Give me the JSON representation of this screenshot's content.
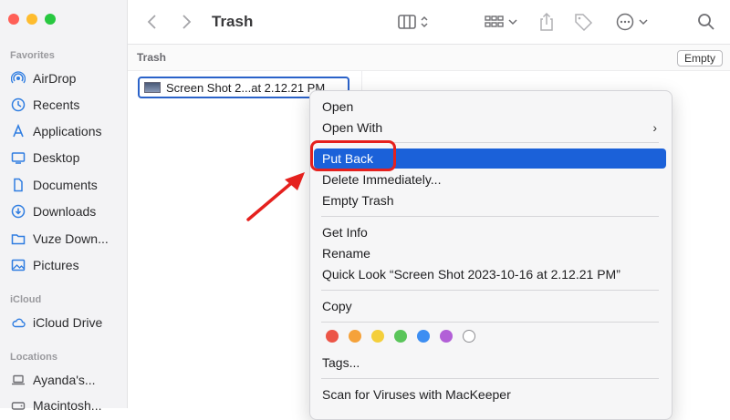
{
  "window": {
    "title": "Trash",
    "traffic_colors": [
      "#ff5f57",
      "#febc2e",
      "#28c840"
    ]
  },
  "sidebar": {
    "sections": [
      {
        "label": "Favorites",
        "items": [
          {
            "label": "AirDrop",
            "icon": "airdrop-icon"
          },
          {
            "label": "Recents",
            "icon": "clock-icon"
          },
          {
            "label": "Applications",
            "icon": "applications-icon"
          },
          {
            "label": "Desktop",
            "icon": "desktop-icon"
          },
          {
            "label": "Documents",
            "icon": "document-icon"
          },
          {
            "label": "Downloads",
            "icon": "download-icon"
          },
          {
            "label": "Vuze Down...",
            "icon": "folder-icon"
          },
          {
            "label": "Pictures",
            "icon": "pictures-icon"
          }
        ]
      },
      {
        "label": "iCloud",
        "items": [
          {
            "label": "iCloud Drive",
            "icon": "cloud-icon"
          }
        ]
      },
      {
        "label": "Locations",
        "items": [
          {
            "label": "Ayanda's...",
            "icon": "laptop-icon"
          },
          {
            "label": "Macintosh...",
            "icon": "disk-icon"
          }
        ]
      }
    ]
  },
  "path_bar": {
    "label": "Trash",
    "empty_button": "Empty"
  },
  "file": {
    "name": "Screen Shot 2...at 2.12.21 PM"
  },
  "context_menu": {
    "items": {
      "open": "Open",
      "open_with": "Open With",
      "put_back": "Put Back",
      "delete_immediately": "Delete Immediately...",
      "empty_trash": "Empty Trash",
      "get_info": "Get Info",
      "rename": "Rename",
      "quick_look": "Quick Look “Screen Shot 2023-10-16 at 2.12.21 PM”",
      "copy": "Copy",
      "tags": "Tags...",
      "scan": "Scan for Viruses with MacKeeper"
    },
    "open_with_arrow": "›",
    "tag_colors": [
      "#ec5547",
      "#f5a23a",
      "#f4cf3b",
      "#5ac55a",
      "#3d8ef2",
      "#b25fd7",
      "#ffffff"
    ],
    "selected": "Put Back"
  },
  "annotation": {
    "highlight_color": "#e5211e"
  }
}
